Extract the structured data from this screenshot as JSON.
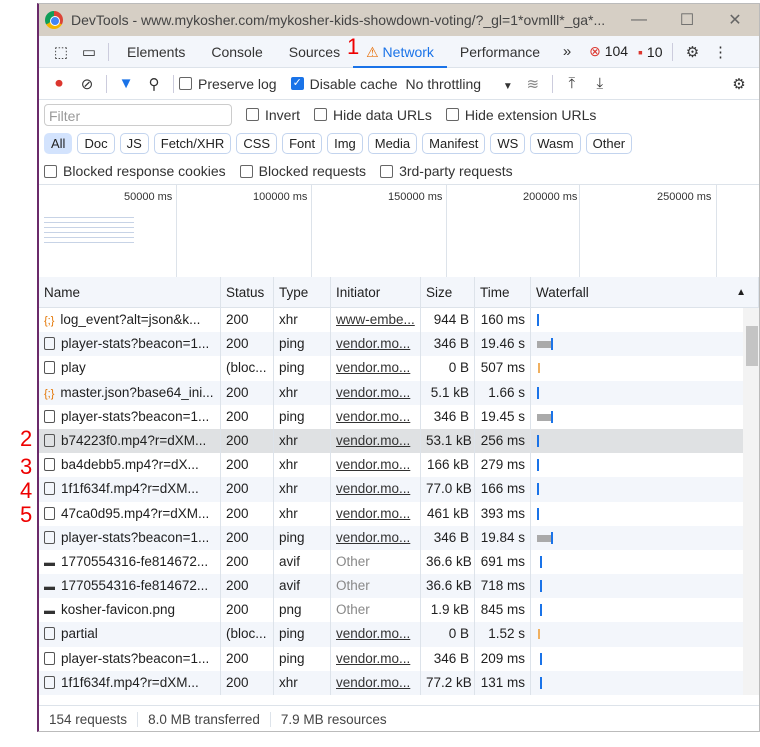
{
  "window": {
    "title": "DevTools - www.mykosher.com/mykosher-kids-showdown-voting/?_gl=1*ovmlll*_ga*..."
  },
  "tabs": [
    "Elements",
    "Console",
    "Sources",
    "Network",
    "Performance"
  ],
  "active_tab": "Network",
  "badges": {
    "errors": "104",
    "issues": "10"
  },
  "toolbar": {
    "preserve_log": "Preserve log",
    "preserve_log_checked": false,
    "disable_cache": "Disable cache",
    "disable_cache_checked": true,
    "throttling": "No throttling"
  },
  "filter": {
    "placeholder": "Filter",
    "invert": "Invert",
    "hide_data_urls": "Hide data URLs",
    "hide_extension_urls": "Hide extension URLs"
  },
  "type_filters": [
    "All",
    "Doc",
    "JS",
    "Fetch/XHR",
    "CSS",
    "Font",
    "Img",
    "Media",
    "Manifest",
    "WS",
    "Wasm",
    "Other"
  ],
  "active_type_filter": "All",
  "extra_filters": [
    "Blocked response cookies",
    "Blocked requests",
    "3rd-party requests"
  ],
  "overview_ticks": [
    "50000 ms",
    "100000 ms",
    "150000 ms",
    "200000 ms",
    "250000 ms"
  ],
  "columns": [
    "Name",
    "Status",
    "Type",
    "Initiator",
    "Size",
    "Time",
    "Waterfall"
  ],
  "rows": [
    {
      "icon": "json",
      "name": "log_event?alt=json&k...",
      "status": "200",
      "type": "xhr",
      "initiator": "www-embe...",
      "size": "944 B",
      "time": "160 ms"
    },
    {
      "icon": "doc",
      "name": "player-stats?beacon=1...",
      "status": "200",
      "type": "ping",
      "initiator": "vendor.mo...",
      "size": "346 B",
      "time": "19.46 s"
    },
    {
      "icon": "doc",
      "name": "play",
      "status": "(bloc...",
      "type": "ping",
      "initiator": "vendor.mo...",
      "size": "0 B",
      "time": "507 ms"
    },
    {
      "icon": "json",
      "name": "master.json?base64_ini...",
      "status": "200",
      "type": "xhr",
      "initiator": "vendor.mo...",
      "size": "5.1 kB",
      "time": "1.66 s"
    },
    {
      "icon": "doc",
      "name": "player-stats?beacon=1...",
      "status": "200",
      "type": "ping",
      "initiator": "vendor.mo...",
      "size": "346 B",
      "time": "19.45 s"
    },
    {
      "icon": "file",
      "name": "b74223f0.mp4?r=dXM...",
      "status": "200",
      "type": "xhr",
      "initiator": "vendor.mo...",
      "size": "53.1 kB",
      "time": "256 ms"
    },
    {
      "icon": "file",
      "name": "ba4debb5.mp4?r=dX...",
      "status": "200",
      "type": "xhr",
      "initiator": "vendor.mo...",
      "size": "166 kB",
      "time": "279 ms"
    },
    {
      "icon": "file",
      "name": "1f1f634f.mp4?r=dXM...",
      "status": "200",
      "type": "xhr",
      "initiator": "vendor.mo...",
      "size": "77.0 kB",
      "time": "166 ms"
    },
    {
      "icon": "file",
      "name": "47ca0d95.mp4?r=dXM...",
      "status": "200",
      "type": "xhr",
      "initiator": "vendor.mo...",
      "size": "461 kB",
      "time": "393 ms"
    },
    {
      "icon": "doc",
      "name": "player-stats?beacon=1...",
      "status": "200",
      "type": "ping",
      "initiator": "vendor.mo...",
      "size": "346 B",
      "time": "19.84 s"
    },
    {
      "icon": "image",
      "name": "1770554316-fe814672...",
      "status": "200",
      "type": "avif",
      "initiator": "Other",
      "size": "36.6 kB",
      "time": "691 ms"
    },
    {
      "icon": "image",
      "name": "1770554316-fe814672...",
      "status": "200",
      "type": "avif",
      "initiator": "Other",
      "size": "36.6 kB",
      "time": "718 ms"
    },
    {
      "icon": "image",
      "name": "kosher-favicon.png",
      "status": "200",
      "type": "png",
      "initiator": "Other",
      "size": "1.9 kB",
      "time": "845 ms"
    },
    {
      "icon": "doc",
      "name": "partial",
      "status": "(bloc...",
      "type": "ping",
      "initiator": "vendor.mo...",
      "size": "0 B",
      "time": "1.52 s"
    },
    {
      "icon": "doc",
      "name": "player-stats?beacon=1...",
      "status": "200",
      "type": "ping",
      "initiator": "vendor.mo...",
      "size": "346 B",
      "time": "209 ms"
    },
    {
      "icon": "file",
      "name": "1f1f634f.mp4?r=dXM...",
      "status": "200",
      "type": "xhr",
      "initiator": "vendor.mo...",
      "size": "77.2 kB",
      "time": "131 ms"
    }
  ],
  "selected_row": 5,
  "footer": {
    "requests": "154 requests",
    "transferred": "8.0 MB transferred",
    "resources": "7.9 MB resources"
  },
  "annotations": [
    "1",
    "2",
    "3",
    "4",
    "5"
  ]
}
